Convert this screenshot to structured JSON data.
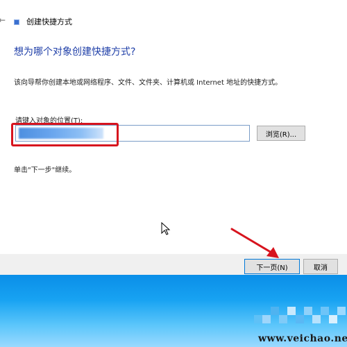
{
  "window": {
    "back_glyph": "←",
    "title": "创建快捷方式"
  },
  "wizard": {
    "heading": "想为哪个对象创建快捷方式?",
    "description": "该向导帮你创建本地或网络程序、文件、文件夹、计算机或 Internet 地址的快捷方式。",
    "location_label": "请键入对象的位置(T):",
    "location_value": "",
    "browse_label": "浏览(R)...",
    "hint": "单击\"下一步\"继续。"
  },
  "footer": {
    "next_label": "下一页(N)",
    "cancel_label": "取消"
  },
  "watermark": "www.veichao.net",
  "colors": {
    "heading": "#1f3fa8",
    "highlight": "#d7141e",
    "desktop": "#0a8ee8"
  },
  "icons": [
    "back-arrow-icon",
    "wizard-icon",
    "mouse-cursor-icon"
  ]
}
